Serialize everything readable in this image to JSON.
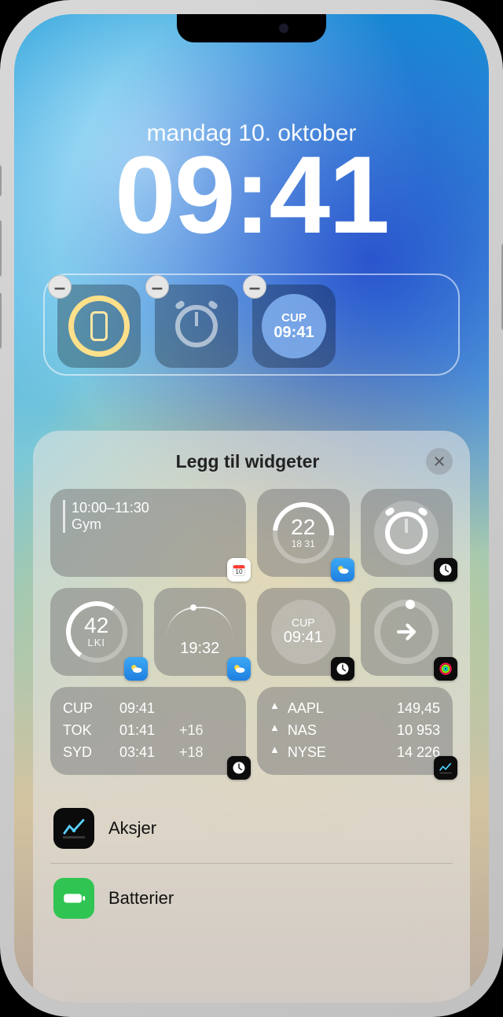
{
  "lockscreen": {
    "date": "mandag 10. oktober",
    "time": "09:41",
    "widgets": [
      {
        "kind": "battery-ring",
        "icon": "phone-icon"
      },
      {
        "kind": "alarm-icon"
      },
      {
        "kind": "world-clock",
        "label": "CUP",
        "value": "09:41"
      }
    ]
  },
  "panel": {
    "title": "Legg til widgeter",
    "suggestions": {
      "calendar_event": {
        "time": "10:00–11:30",
        "title": "Gym"
      },
      "weather_gauge": {
        "value": "22",
        "low": "18",
        "high": "31"
      },
      "alarm": {},
      "aqi": {
        "value": "42",
        "label": "LKI"
      },
      "sunset": {
        "time": "19:32"
      },
      "world_clock_small": {
        "label": "CUP",
        "value": "09:41"
      },
      "fitness_arrow": {},
      "world_clock_list": {
        "rows": [
          {
            "city": "CUP",
            "time": "09:41",
            "offset": ""
          },
          {
            "city": "TOK",
            "time": "01:41",
            "offset": "+16"
          },
          {
            "city": "SYD",
            "time": "03:41",
            "offset": "+18"
          }
        ]
      },
      "stocks_list": {
        "rows": [
          {
            "dir": "▲",
            "symbol": "AAPL",
            "price": "149,45"
          },
          {
            "dir": "▲",
            "symbol": "NAS",
            "price": "10 953"
          },
          {
            "dir": "▲",
            "symbol": "NYSE",
            "price": "14 226"
          }
        ]
      }
    },
    "apps": [
      {
        "id": "stocks",
        "label": "Aksjer"
      },
      {
        "id": "batteries",
        "label": "Batterier"
      }
    ]
  }
}
